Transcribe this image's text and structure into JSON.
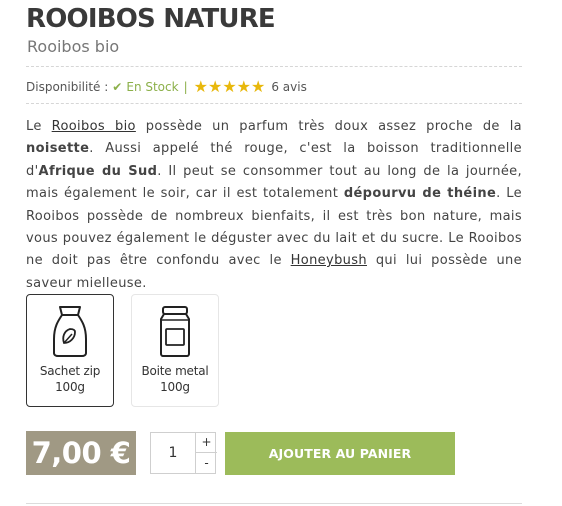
{
  "product": {
    "title": "ROOIBOS NATURE",
    "subtitle": "Rooibos bio"
  },
  "meta": {
    "availability_label": "Disponibilité :",
    "stock_status": "En Stock",
    "separator": "|",
    "rating_stars": 5,
    "reviews": "6 avis"
  },
  "description": {
    "t1": "Le ",
    "l1": "Rooibos bio",
    "t2": " possède un parfum très doux assez proche de la ",
    "b1": "noisette",
    "t3": ". Aussi appelé thé rouge, c'est la boisson traditionnelle d'",
    "b2": "Afrique du Sud",
    "t4": ". Il peut se consommer tout au long de la journée, mais également le soir, car il est totalement ",
    "b3": "dépourvu de théine",
    "t5": ". Le Rooibos possède de nombreux bienfaits, il est très bon nature, mais vous pouvez également le déguster avec du lait et du sucre. Le Rooibos ne doit pas être confondu avec le ",
    "l2": "Honeybush",
    "t6": " qui lui possède une saveur mielleuse."
  },
  "options": [
    {
      "label": "Sachet zip",
      "weight": "100g",
      "selected": true,
      "icon": "zip-bag-icon"
    },
    {
      "label": "Boite metal",
      "weight": "100g",
      "selected": false,
      "icon": "metal-tin-icon"
    }
  ],
  "purchase": {
    "price": "7,00 €",
    "quantity": "1",
    "plus": "+",
    "minus": "-",
    "add_to_cart": "AJOUTER AU PANIER"
  },
  "colors": {
    "accent_green": "#9cbb5a",
    "stock_green": "#8cb04a",
    "price_bg": "#a09984",
    "star": "#e8b80c"
  }
}
